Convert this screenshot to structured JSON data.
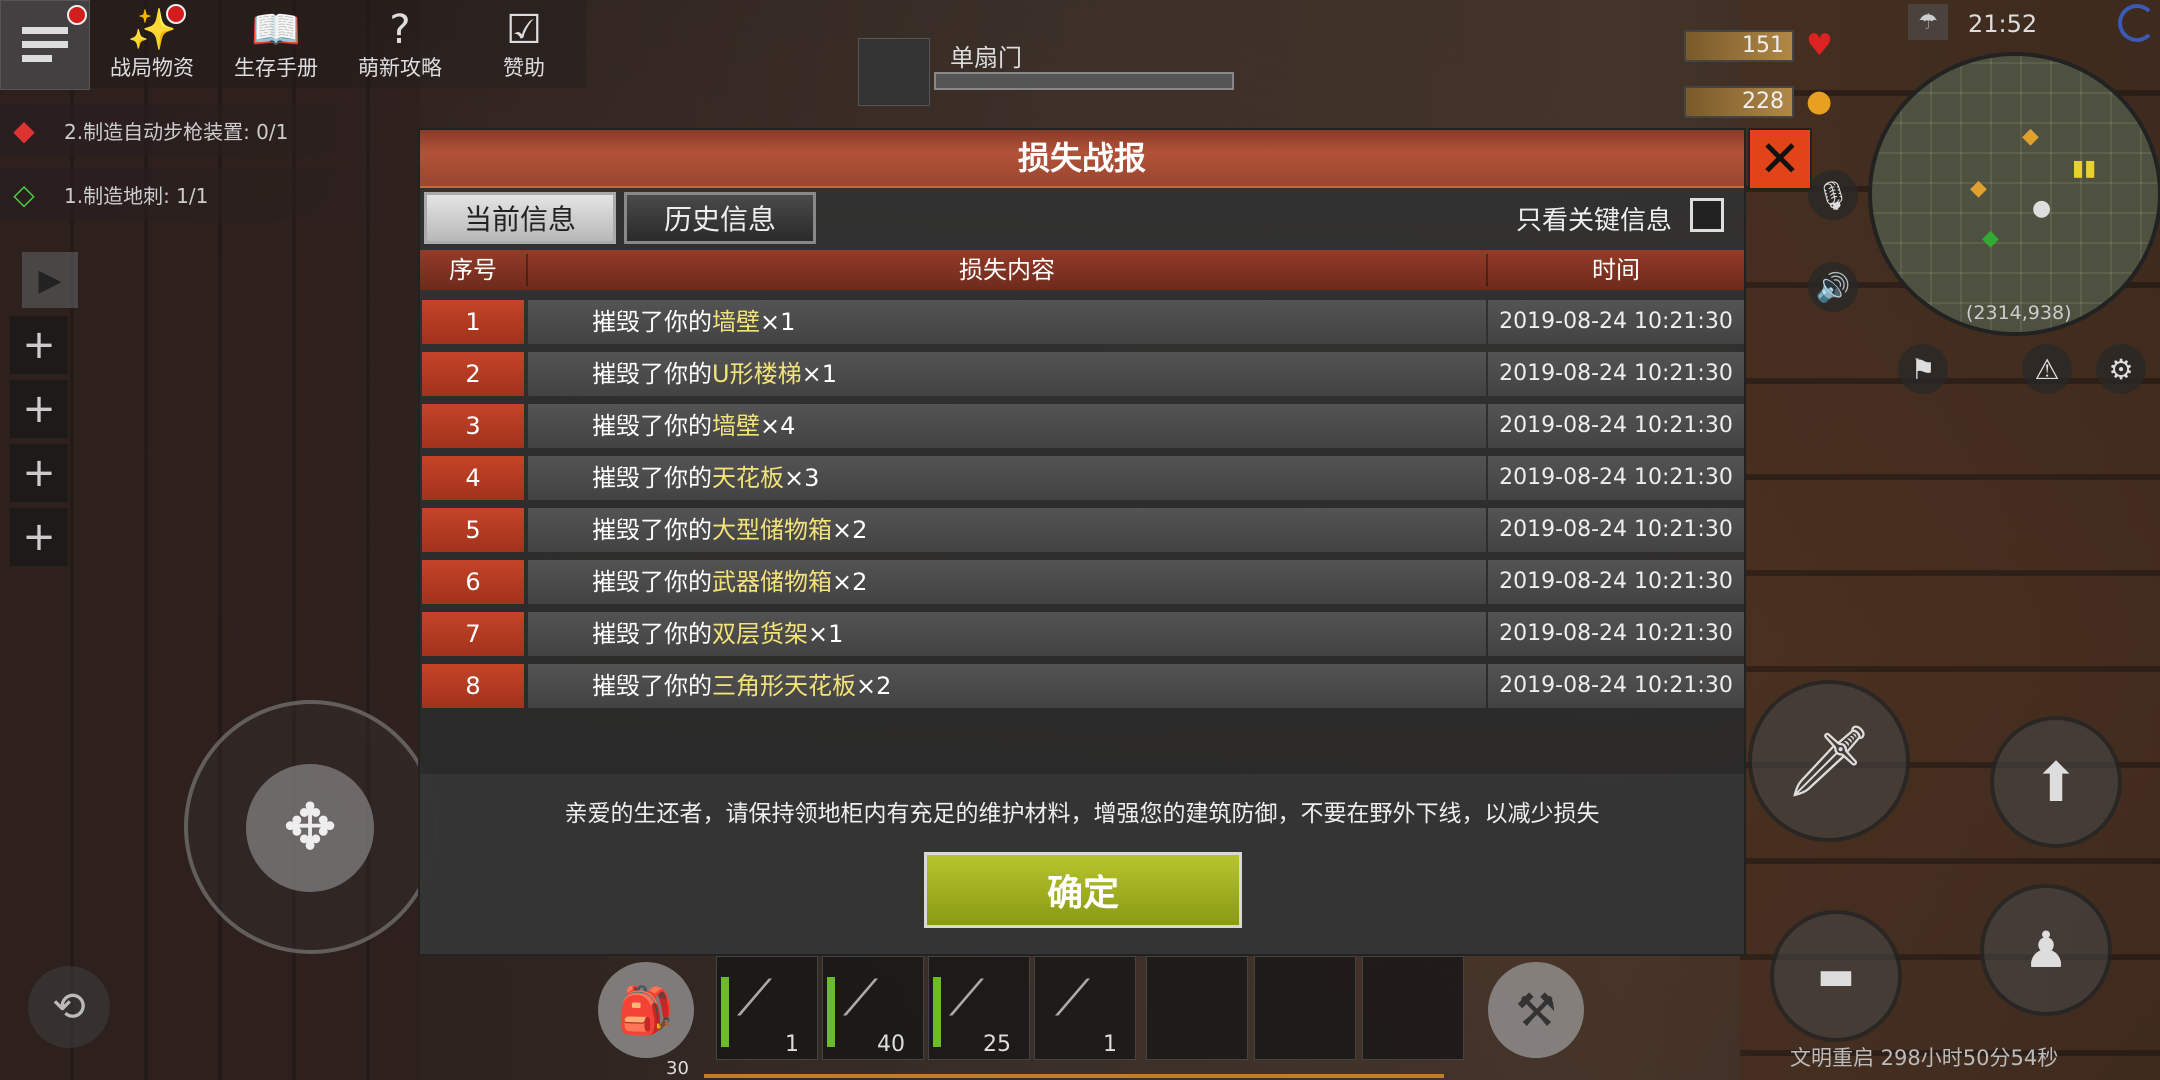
{
  "toolbar": {
    "items": [
      {
        "label": "战局物资",
        "icon": "firework-icon"
      },
      {
        "label": "生存手册",
        "icon": "book-icon"
      },
      {
        "label": "萌新攻略",
        "icon": "help-icon"
      },
      {
        "label": "赞助",
        "icon": "list-check-icon"
      }
    ]
  },
  "quests": [
    {
      "text": "2.制造自动步枪装置: 0/1",
      "status": "incomplete"
    },
    {
      "text": "1.制造地刺: 1/1",
      "status": "complete"
    }
  ],
  "target": {
    "name": "单扇门"
  },
  "stats": {
    "health": "151",
    "hunger": "228"
  },
  "status_bar": {
    "time": "21:52"
  },
  "minimap": {
    "coords": "(2314,938)"
  },
  "dialog": {
    "title": "损失战报",
    "tabs": [
      "当前信息",
      "历史信息"
    ],
    "active_tab": "当前信息",
    "filter_label": "只看关键信息",
    "filter_checked": false,
    "columns": {
      "index": "序号",
      "content": "损失内容",
      "time": "时间"
    },
    "rows": [
      {
        "num": "1",
        "prefix": "摧毁了你的",
        "item": "墙壁",
        "qty": "×1",
        "time": "2019-08-24 10:21:30"
      },
      {
        "num": "2",
        "prefix": "摧毁了你的",
        "item": "U形楼梯",
        "qty": "×1",
        "time": "2019-08-24 10:21:30"
      },
      {
        "num": "3",
        "prefix": "摧毁了你的",
        "item": "墙壁",
        "qty": "×4",
        "time": "2019-08-24 10:21:30"
      },
      {
        "num": "4",
        "prefix": "摧毁了你的",
        "item": "天花板",
        "qty": "×3",
        "time": "2019-08-24 10:21:30"
      },
      {
        "num": "5",
        "prefix": "摧毁了你的",
        "item": "大型储物箱",
        "qty": "×2",
        "time": "2019-08-24 10:21:30"
      },
      {
        "num": "6",
        "prefix": "摧毁了你的",
        "item": "武器储物箱",
        "qty": "×2",
        "time": "2019-08-24 10:21:30"
      },
      {
        "num": "7",
        "prefix": "摧毁了你的",
        "item": "双层货架",
        "qty": "×1",
        "time": "2019-08-24 10:21:30"
      },
      {
        "num": "8",
        "prefix": "摧毁了你的",
        "item": "三角形天花板",
        "qty": "×2",
        "time": "2019-08-24 10:21:30"
      }
    ],
    "notice": "亲爱的生还者，请保持领地柜内有充足的维护材料，增强您的建筑防御，不要在野外下线，以减少损失",
    "confirm_label": "确定"
  },
  "hotbar": {
    "slot_counts": [
      "1",
      "40",
      "25",
      "1",
      "",
      "",
      ""
    ],
    "slot_icons": [
      "machete-icon",
      "rifle-icon",
      "rifle-icon",
      "syringe-icon",
      "",
      "",
      ""
    ],
    "hotbar_number": "30"
  },
  "footer": {
    "restart_text": "文明重启 298小时50分54秒"
  },
  "colors": {
    "accent_red": "#b25238",
    "highlight_yellow": "#f2e27a",
    "confirm_green": "#a3b222",
    "close_orange": "#e04418"
  }
}
